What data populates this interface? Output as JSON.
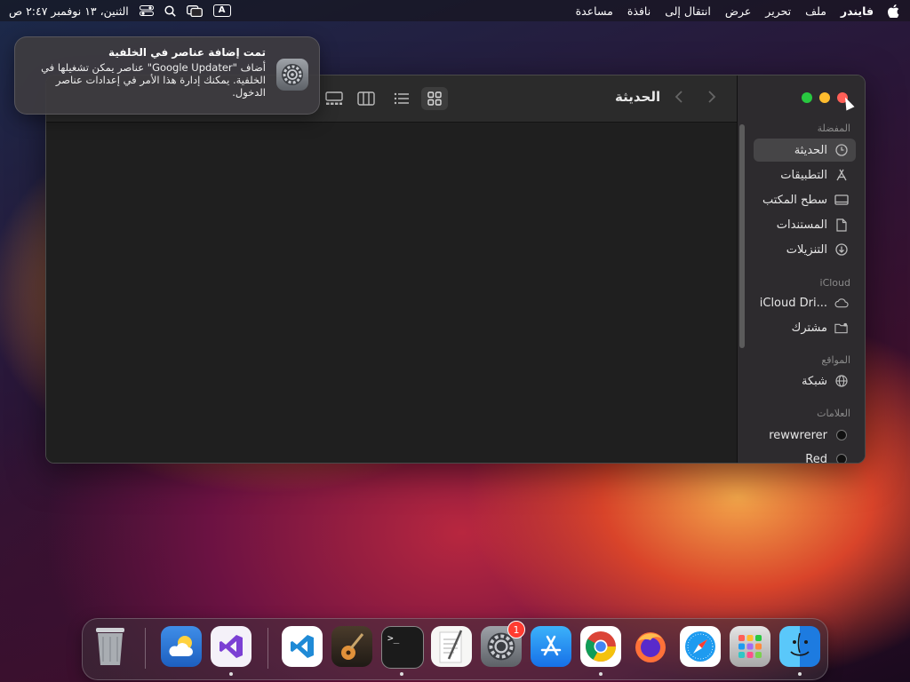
{
  "menubar": {
    "apple": "",
    "app_name": "فايندر",
    "menus": [
      "ملف",
      "تحرير",
      "عرض",
      "انتقال إلى",
      "نافذة",
      "مساعدة"
    ],
    "input_source": "A",
    "datetime": "الثنين، ١٣ نوفمبر ٢:٤٧ ص"
  },
  "notification": {
    "title": "تمت إضافة عناصر في الخلفية",
    "body": "أضاف \"Google Updater\" عناصر يمكن تشغيلها في الخلفية. يمكنك إدارة هذا الأمر في إعدادات عناصر الدخول.",
    "icon": "settings-gear-icon"
  },
  "finder": {
    "title": "الحديثة",
    "sidebar": {
      "favorites_label": "المفضلة",
      "favorites": [
        {
          "label": "الحديثة",
          "icon": "clock-icon",
          "selected": true
        },
        {
          "label": "التطبيقات",
          "icon": "applications-icon"
        },
        {
          "label": "سطح المكتب",
          "icon": "desktop-icon"
        },
        {
          "label": "المستندات",
          "icon": "document-icon"
        },
        {
          "label": "التنزيلات",
          "icon": "download-icon"
        }
      ],
      "icloud_label": "iCloud",
      "icloud": [
        {
          "label": "iCloud Dri...",
          "icon": "cloud-icon"
        },
        {
          "label": "مشترك",
          "icon": "shared-folder-icon"
        }
      ],
      "locations_label": "المواقع",
      "locations": [
        {
          "label": "شبكة",
          "icon": "globe-icon"
        }
      ],
      "tags_label": "العلامات",
      "tags": [
        {
          "label": "rewwrerer"
        },
        {
          "label": "Red"
        }
      ]
    }
  },
  "dock": {
    "settings_badge": "1",
    "apps": [
      "trash",
      "weather",
      "visual-studio",
      "vscode",
      "garageband",
      "terminal",
      "textedit",
      "system-settings",
      "app-store",
      "chrome",
      "firefox",
      "safari",
      "launchpad",
      "finder"
    ]
  }
}
